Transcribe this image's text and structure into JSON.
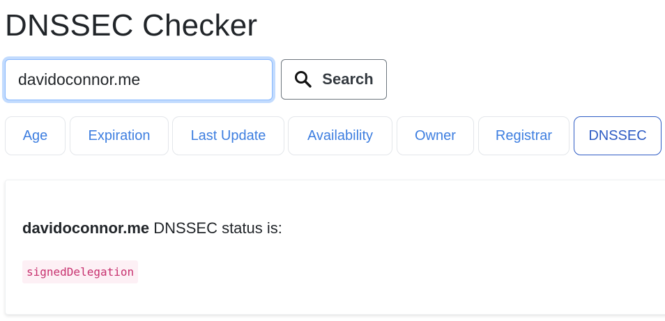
{
  "header": {
    "title": "DNSSEC Checker"
  },
  "search": {
    "value": "davidoconnor.me",
    "button_label": "Search",
    "button_icon": "search-icon"
  },
  "tabs": [
    {
      "label": "Age",
      "active": false
    },
    {
      "label": "Expiration",
      "active": false
    },
    {
      "label": "Last Update",
      "active": false
    },
    {
      "label": "Availability",
      "active": false
    },
    {
      "label": "Owner",
      "active": false
    },
    {
      "label": "Registrar",
      "active": false
    },
    {
      "label": "DNSSEC",
      "active": true
    }
  ],
  "result": {
    "domain": "davidoconnor.me",
    "status_text": " DNSSEC status is:",
    "status_value": "signedDelegation"
  },
  "colors": {
    "tab_text": "#3d7ee0",
    "tab_active": "#2d5bc4",
    "code_text": "#c7306e",
    "code_bg": "#fdf0f5",
    "input_focus": "#86b7fe"
  }
}
